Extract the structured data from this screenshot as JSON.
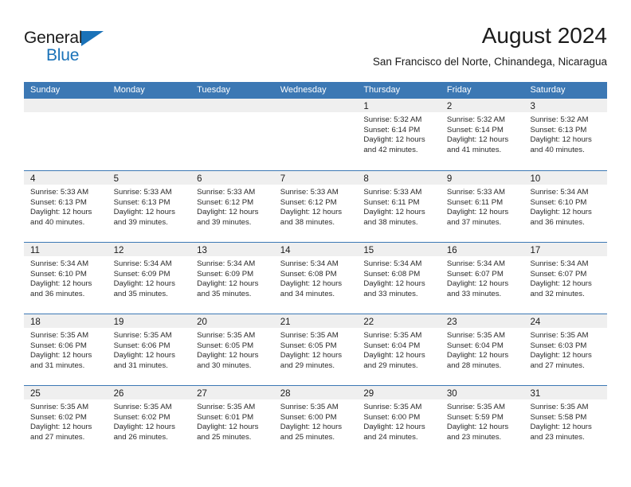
{
  "brand": {
    "name_line1": "General",
    "name_line2": "Blue",
    "triangle_icon": "triangle-icon",
    "accent_color": "#1a72b8"
  },
  "header": {
    "title": "August 2024",
    "subtitle": "San Francisco del Norte, Chinandega, Nicaragua"
  },
  "colors": {
    "header_blue": "#3c78b4",
    "daynum_band": "#efefef",
    "text": "#1b1b1b"
  },
  "weekdays": [
    "Sunday",
    "Monday",
    "Tuesday",
    "Wednesday",
    "Thursday",
    "Friday",
    "Saturday"
  ],
  "weeks": [
    [
      {
        "day": "",
        "empty": true
      },
      {
        "day": "",
        "empty": true
      },
      {
        "day": "",
        "empty": true
      },
      {
        "day": "",
        "empty": true
      },
      {
        "day": "1",
        "sunrise": "Sunrise: 5:32 AM",
        "sunset": "Sunset: 6:14 PM",
        "daylight1": "Daylight: 12 hours",
        "daylight2": "and 42 minutes."
      },
      {
        "day": "2",
        "sunrise": "Sunrise: 5:32 AM",
        "sunset": "Sunset: 6:14 PM",
        "daylight1": "Daylight: 12 hours",
        "daylight2": "and 41 minutes."
      },
      {
        "day": "3",
        "sunrise": "Sunrise: 5:32 AM",
        "sunset": "Sunset: 6:13 PM",
        "daylight1": "Daylight: 12 hours",
        "daylight2": "and 40 minutes."
      }
    ],
    [
      {
        "day": "4",
        "sunrise": "Sunrise: 5:33 AM",
        "sunset": "Sunset: 6:13 PM",
        "daylight1": "Daylight: 12 hours",
        "daylight2": "and 40 minutes."
      },
      {
        "day": "5",
        "sunrise": "Sunrise: 5:33 AM",
        "sunset": "Sunset: 6:13 PM",
        "daylight1": "Daylight: 12 hours",
        "daylight2": "and 39 minutes."
      },
      {
        "day": "6",
        "sunrise": "Sunrise: 5:33 AM",
        "sunset": "Sunset: 6:12 PM",
        "daylight1": "Daylight: 12 hours",
        "daylight2": "and 39 minutes."
      },
      {
        "day": "7",
        "sunrise": "Sunrise: 5:33 AM",
        "sunset": "Sunset: 6:12 PM",
        "daylight1": "Daylight: 12 hours",
        "daylight2": "and 38 minutes."
      },
      {
        "day": "8",
        "sunrise": "Sunrise: 5:33 AM",
        "sunset": "Sunset: 6:11 PM",
        "daylight1": "Daylight: 12 hours",
        "daylight2": "and 38 minutes."
      },
      {
        "day": "9",
        "sunrise": "Sunrise: 5:33 AM",
        "sunset": "Sunset: 6:11 PM",
        "daylight1": "Daylight: 12 hours",
        "daylight2": "and 37 minutes."
      },
      {
        "day": "10",
        "sunrise": "Sunrise: 5:34 AM",
        "sunset": "Sunset: 6:10 PM",
        "daylight1": "Daylight: 12 hours",
        "daylight2": "and 36 minutes."
      }
    ],
    [
      {
        "day": "11",
        "sunrise": "Sunrise: 5:34 AM",
        "sunset": "Sunset: 6:10 PM",
        "daylight1": "Daylight: 12 hours",
        "daylight2": "and 36 minutes."
      },
      {
        "day": "12",
        "sunrise": "Sunrise: 5:34 AM",
        "sunset": "Sunset: 6:09 PM",
        "daylight1": "Daylight: 12 hours",
        "daylight2": "and 35 minutes."
      },
      {
        "day": "13",
        "sunrise": "Sunrise: 5:34 AM",
        "sunset": "Sunset: 6:09 PM",
        "daylight1": "Daylight: 12 hours",
        "daylight2": "and 35 minutes."
      },
      {
        "day": "14",
        "sunrise": "Sunrise: 5:34 AM",
        "sunset": "Sunset: 6:08 PM",
        "daylight1": "Daylight: 12 hours",
        "daylight2": "and 34 minutes."
      },
      {
        "day": "15",
        "sunrise": "Sunrise: 5:34 AM",
        "sunset": "Sunset: 6:08 PM",
        "daylight1": "Daylight: 12 hours",
        "daylight2": "and 33 minutes."
      },
      {
        "day": "16",
        "sunrise": "Sunrise: 5:34 AM",
        "sunset": "Sunset: 6:07 PM",
        "daylight1": "Daylight: 12 hours",
        "daylight2": "and 33 minutes."
      },
      {
        "day": "17",
        "sunrise": "Sunrise: 5:34 AM",
        "sunset": "Sunset: 6:07 PM",
        "daylight1": "Daylight: 12 hours",
        "daylight2": "and 32 minutes."
      }
    ],
    [
      {
        "day": "18",
        "sunrise": "Sunrise: 5:35 AM",
        "sunset": "Sunset: 6:06 PM",
        "daylight1": "Daylight: 12 hours",
        "daylight2": "and 31 minutes."
      },
      {
        "day": "19",
        "sunrise": "Sunrise: 5:35 AM",
        "sunset": "Sunset: 6:06 PM",
        "daylight1": "Daylight: 12 hours",
        "daylight2": "and 31 minutes."
      },
      {
        "day": "20",
        "sunrise": "Sunrise: 5:35 AM",
        "sunset": "Sunset: 6:05 PM",
        "daylight1": "Daylight: 12 hours",
        "daylight2": "and 30 minutes."
      },
      {
        "day": "21",
        "sunrise": "Sunrise: 5:35 AM",
        "sunset": "Sunset: 6:05 PM",
        "daylight1": "Daylight: 12 hours",
        "daylight2": "and 29 minutes."
      },
      {
        "day": "22",
        "sunrise": "Sunrise: 5:35 AM",
        "sunset": "Sunset: 6:04 PM",
        "daylight1": "Daylight: 12 hours",
        "daylight2": "and 29 minutes."
      },
      {
        "day": "23",
        "sunrise": "Sunrise: 5:35 AM",
        "sunset": "Sunset: 6:04 PM",
        "daylight1": "Daylight: 12 hours",
        "daylight2": "and 28 minutes."
      },
      {
        "day": "24",
        "sunrise": "Sunrise: 5:35 AM",
        "sunset": "Sunset: 6:03 PM",
        "daylight1": "Daylight: 12 hours",
        "daylight2": "and 27 minutes."
      }
    ],
    [
      {
        "day": "25",
        "sunrise": "Sunrise: 5:35 AM",
        "sunset": "Sunset: 6:02 PM",
        "daylight1": "Daylight: 12 hours",
        "daylight2": "and 27 minutes."
      },
      {
        "day": "26",
        "sunrise": "Sunrise: 5:35 AM",
        "sunset": "Sunset: 6:02 PM",
        "daylight1": "Daylight: 12 hours",
        "daylight2": "and 26 minutes."
      },
      {
        "day": "27",
        "sunrise": "Sunrise: 5:35 AM",
        "sunset": "Sunset: 6:01 PM",
        "daylight1": "Daylight: 12 hours",
        "daylight2": "and 25 minutes."
      },
      {
        "day": "28",
        "sunrise": "Sunrise: 5:35 AM",
        "sunset": "Sunset: 6:00 PM",
        "daylight1": "Daylight: 12 hours",
        "daylight2": "and 25 minutes."
      },
      {
        "day": "29",
        "sunrise": "Sunrise: 5:35 AM",
        "sunset": "Sunset: 6:00 PM",
        "daylight1": "Daylight: 12 hours",
        "daylight2": "and 24 minutes."
      },
      {
        "day": "30",
        "sunrise": "Sunrise: 5:35 AM",
        "sunset": "Sunset: 5:59 PM",
        "daylight1": "Daylight: 12 hours",
        "daylight2": "and 23 minutes."
      },
      {
        "day": "31",
        "sunrise": "Sunrise: 5:35 AM",
        "sunset": "Sunset: 5:58 PM",
        "daylight1": "Daylight: 12 hours",
        "daylight2": "and 23 minutes."
      }
    ]
  ]
}
